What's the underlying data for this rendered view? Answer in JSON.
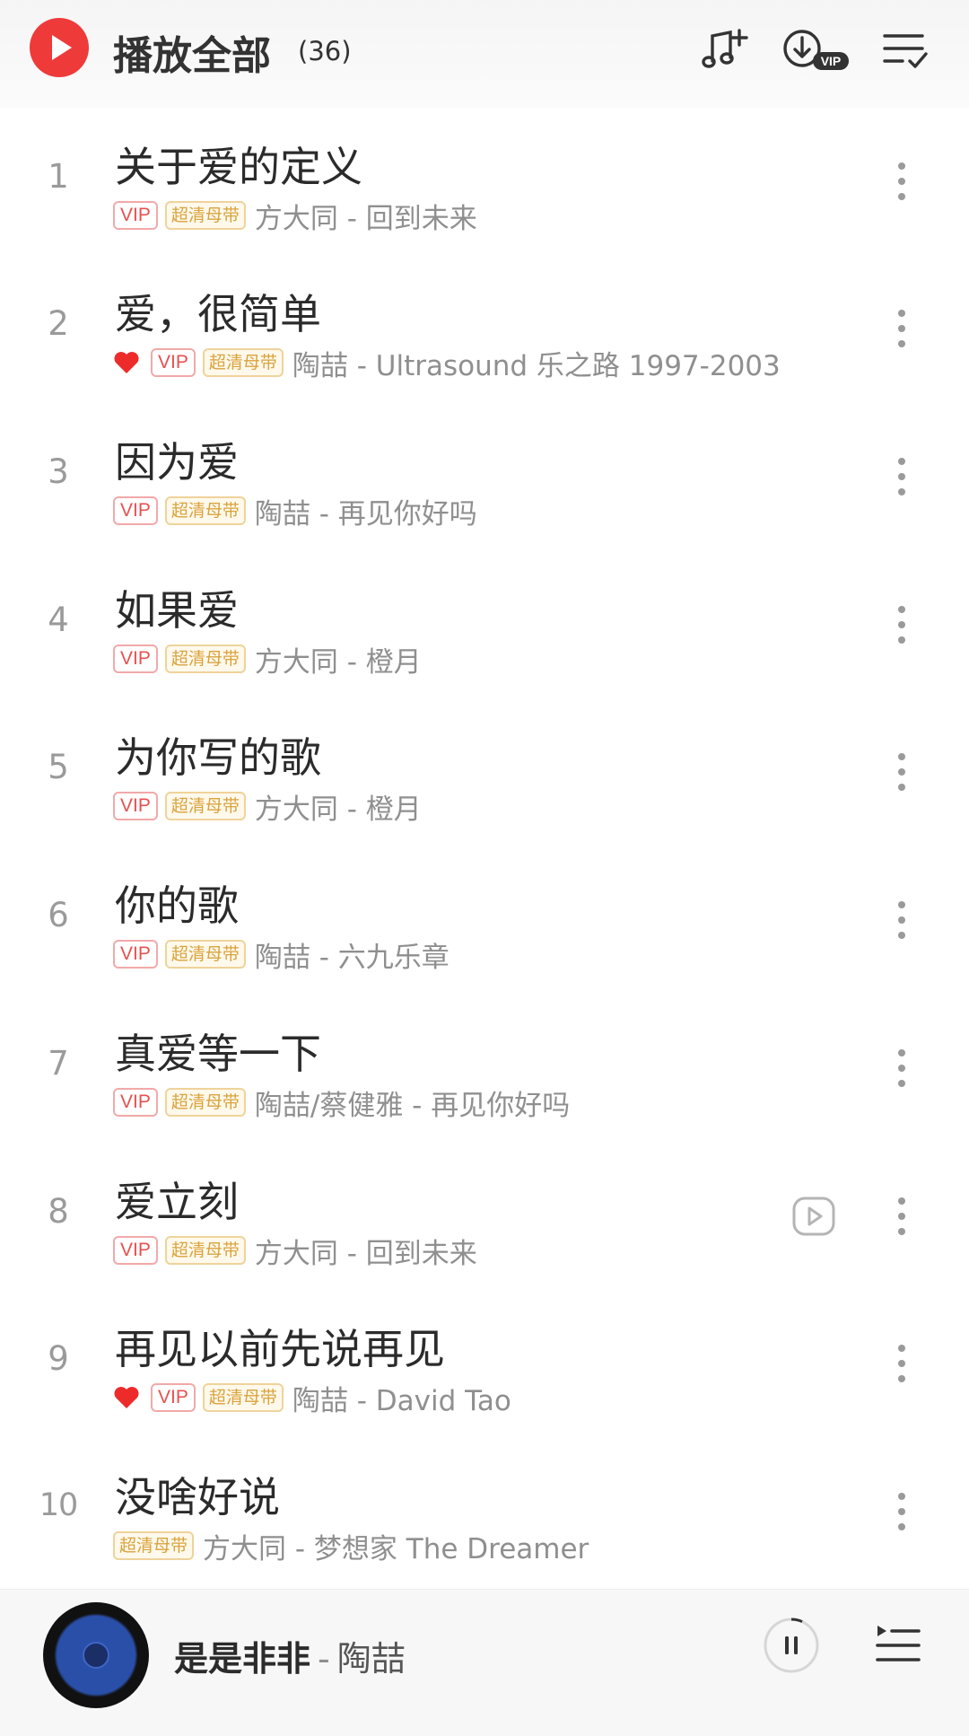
{
  "header": {
    "title": "播放全部",
    "count": "(36)",
    "icons": [
      "play-circle-icon",
      "add-music-icon",
      "download-vip-icon",
      "multi-select-icon"
    ],
    "download_badge": "VIP"
  },
  "badges": {
    "vip": "VIP",
    "master": "超清母带"
  },
  "songs": [
    {
      "index": "1",
      "title": "关于爱的定义",
      "sub": "方大同 - 回到未来",
      "liked": false,
      "vip": true,
      "master": true,
      "mv": false
    },
    {
      "index": "2",
      "title": "爱，很简单",
      "sub": "陶喆 - Ultrasound 乐之路 1997-2003",
      "liked": true,
      "vip": true,
      "master": true,
      "mv": false
    },
    {
      "index": "3",
      "title": "因为爱",
      "sub": "陶喆 - 再见你好吗",
      "liked": false,
      "vip": true,
      "master": true,
      "mv": false
    },
    {
      "index": "4",
      "title": "如果爱",
      "sub": "方大同 - 橙月",
      "liked": false,
      "vip": true,
      "master": true,
      "mv": false
    },
    {
      "index": "5",
      "title": "为你写的歌",
      "sub": "方大同 - 橙月",
      "liked": false,
      "vip": true,
      "master": true,
      "mv": false
    },
    {
      "index": "6",
      "title": "你的歌",
      "sub": "陶喆 - 六九乐章",
      "liked": false,
      "vip": true,
      "master": true,
      "mv": false
    },
    {
      "index": "7",
      "title": "真爱等一下",
      "sub": "陶喆/蔡健雅 - 再见你好吗",
      "liked": false,
      "vip": true,
      "master": true,
      "mv": false
    },
    {
      "index": "8",
      "title": "爱立刻",
      "sub": "方大同 - 回到未来",
      "liked": false,
      "vip": true,
      "master": true,
      "mv": true
    },
    {
      "index": "9",
      "title": "再见以前先说再见",
      "sub": "陶喆 - David Tao",
      "liked": true,
      "vip": true,
      "master": true,
      "mv": false
    },
    {
      "index": "10",
      "title": "没啥好说",
      "sub": "方大同 - 梦想家 The Dreamer",
      "liked": false,
      "vip": false,
      "master": true,
      "mv": false
    }
  ],
  "player": {
    "title": "是是非非",
    "separator": "-",
    "artist": "陶喆",
    "state": "playing"
  },
  "colors": {
    "accent": "#ef3a3a",
    "vip": "#e85050",
    "master": "#d9a33c",
    "heart": "#ee2b2b"
  }
}
